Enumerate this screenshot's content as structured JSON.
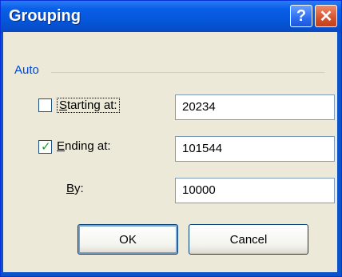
{
  "window": {
    "title": "Grouping",
    "help_glyph": "?",
    "close_glyph": "✕"
  },
  "auto_group": {
    "label": "Auto"
  },
  "starting_at": {
    "label_mnemonic": "S",
    "label_rest": "tarting at:",
    "checked": false,
    "value": "20234"
  },
  "ending_at": {
    "label_mnemonic": "E",
    "label_rest": "nding at:",
    "checked": true,
    "value": "101544"
  },
  "by": {
    "label_mnemonic": "B",
    "label_rest": "y:",
    "value": "10000"
  },
  "buttons": {
    "ok": "OK",
    "cancel": "Cancel"
  },
  "colors": {
    "titlebar": "#0454d6",
    "client_bg": "#ece9d8",
    "group_label": "#0046d5",
    "checkmark": "#21a121"
  },
  "icons": {
    "help": "help-icon",
    "close": "close-icon",
    "check": "checkmark-icon"
  }
}
